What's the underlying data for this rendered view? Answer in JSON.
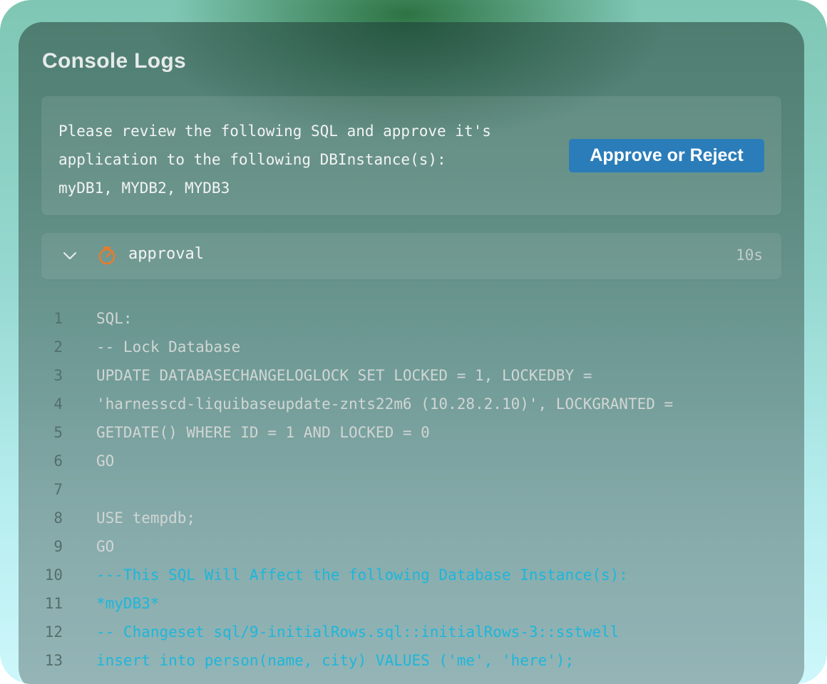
{
  "panel": {
    "title": "Console Logs"
  },
  "approval_prompt": {
    "message": "Please review the following SQL and approve it's\napplication to the following DBInstance(s):\nmyDB1, MYDB2, MYDB3",
    "button_label": "Approve or Reject",
    "button_color": "#2b7db9"
  },
  "step": {
    "name": "approval",
    "duration": "10s",
    "icon": "timer-icon",
    "icon_color": "#f07a23",
    "expanded": true
  },
  "log": {
    "comment_color": "#1cb7db",
    "lines": [
      {
        "num": "1",
        "text": "SQL:",
        "type": "plain"
      },
      {
        "num": "2",
        "text": "-- Lock Database",
        "type": "plain"
      },
      {
        "num": "3",
        "text": "UPDATE DATABASECHANGELOGLOCK SET LOCKED = 1, LOCKEDBY =",
        "type": "plain"
      },
      {
        "num": "4",
        "text": "'harnesscd-liquibaseupdate-znts22m6 (10.28.2.10)', LOCKGRANTED =",
        "type": "plain"
      },
      {
        "num": "5",
        "text": "GETDATE() WHERE ID = 1 AND LOCKED = 0",
        "type": "plain"
      },
      {
        "num": "6",
        "text": "GO",
        "type": "plain"
      },
      {
        "num": "7",
        "text": "",
        "type": "plain"
      },
      {
        "num": "8",
        "text": "USE tempdb;",
        "type": "plain"
      },
      {
        "num": "9",
        "text": "GO",
        "type": "plain"
      },
      {
        "num": "10",
        "text": "---This SQL Will Affect the following Database Instance(s):",
        "type": "comment"
      },
      {
        "num": "11",
        "text": "*myDB3*",
        "type": "comment"
      },
      {
        "num": "12",
        "text": "-- Changeset sql/9-initialRows.sql::initialRows-3::sstwell",
        "type": "comment"
      },
      {
        "num": "13",
        "text": "insert into person(name, city) VALUES ('me', 'here');",
        "type": "comment"
      }
    ]
  }
}
